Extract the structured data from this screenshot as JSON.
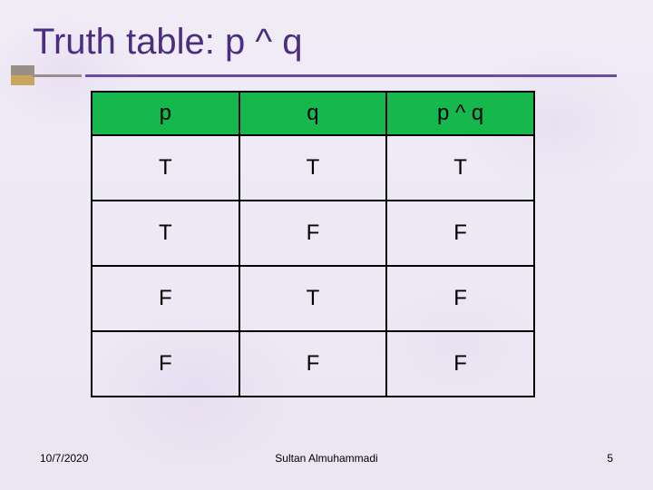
{
  "title": "Truth table:  p ^ q",
  "chart_data": {
    "type": "table",
    "headers": [
      "p",
      "q",
      "p ^ q"
    ],
    "rows": [
      [
        "T",
        "T",
        "T"
      ],
      [
        "T",
        "F",
        "F"
      ],
      [
        "F",
        "T",
        "F"
      ],
      [
        "F",
        "F",
        "F"
      ]
    ]
  },
  "footer": {
    "date": "10/7/2020",
    "author": "Sultan Almuhammadi",
    "page": "5"
  },
  "colors": {
    "title": "#4b2e7f",
    "underline_purple": "#6b4aa0",
    "underline_grey": "#9a8f87",
    "table_header_bg": "#16b84e",
    "table_border": "#000000"
  }
}
